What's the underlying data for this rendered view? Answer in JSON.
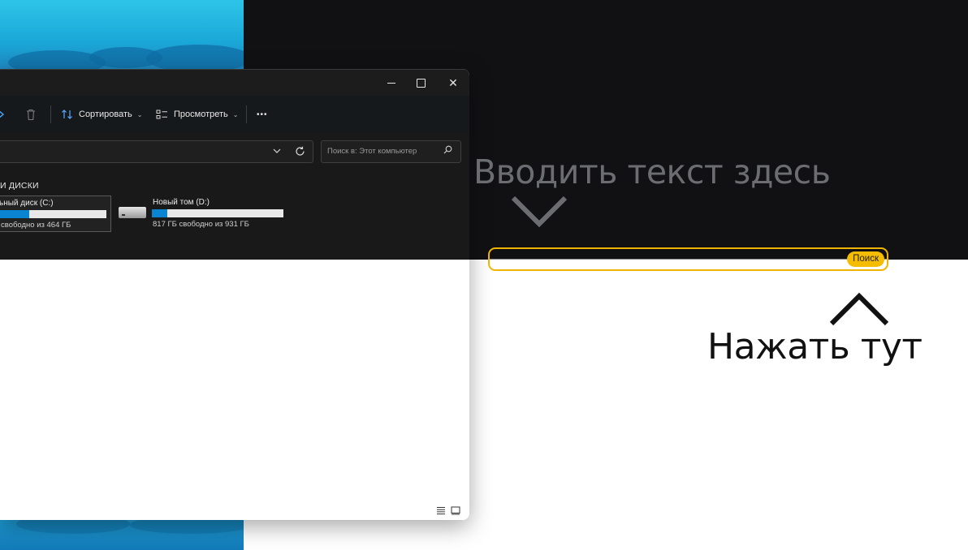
{
  "explorer": {
    "toolbar": {
      "sort_label": "Сортировать",
      "view_label": "Просмотреть",
      "more_label": "•••"
    },
    "search": {
      "placeholder": "Поиск в: Этот компьютер"
    },
    "section_title": "и диски",
    "drives": [
      {
        "name": "ьный диск (C:)",
        "free_text": "свободно из 464 ГБ",
        "used_fraction": 0.3
      },
      {
        "name": "Новый том (D:)",
        "free_text": "817 ГБ свободно из 931 ГБ",
        "used_fraction": 0.12
      }
    ]
  },
  "overlay": {
    "hint": "Вводить текст здесь",
    "search_button": "Поиск",
    "press_hint": "Нажать тут"
  },
  "colors": {
    "accent_yellow": "#f5bc00",
    "drive_bar": "#0a84d0",
    "dark_bg": "#111113"
  }
}
